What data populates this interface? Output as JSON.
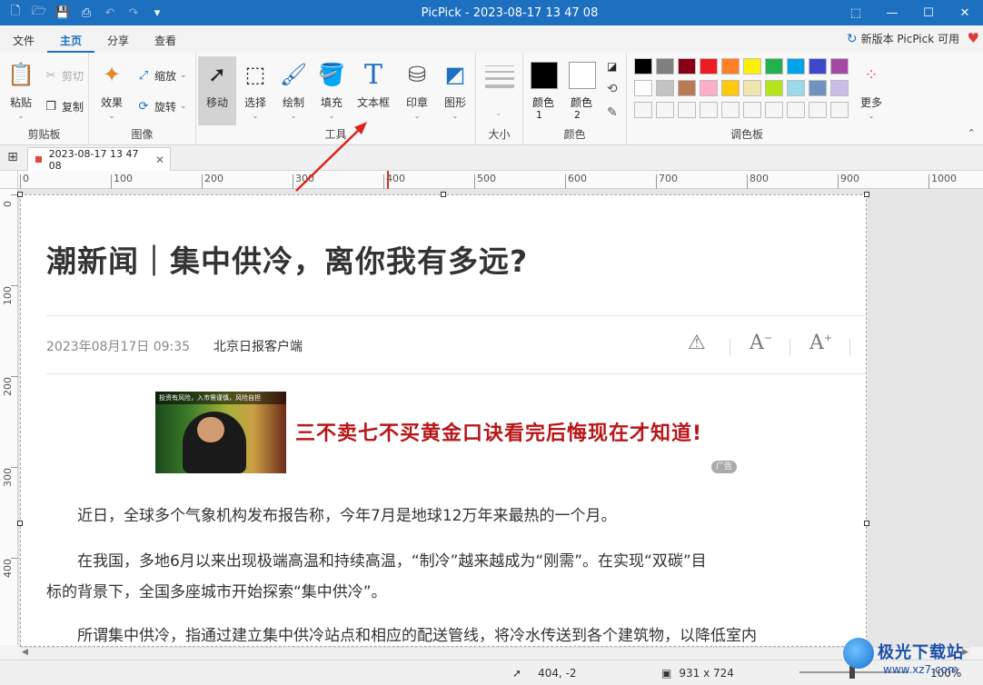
{
  "window": {
    "title": "PicPick - 2023-08-17 13 47 08",
    "controls": [
      "⬚",
      "—",
      "☐",
      "✕"
    ]
  },
  "quick_access": [
    "new-file-icon",
    "open-folder-icon",
    "save-icon",
    "print-icon",
    "undo-icon",
    "redo-icon",
    "customize-icon"
  ],
  "menu": {
    "tabs": [
      "文件",
      "主页",
      "分享",
      "查看"
    ],
    "active": "主页",
    "update_notice": "新版本 PicPick 可用"
  },
  "ribbon": {
    "clipboard": {
      "label": "剪贴板",
      "paste": "粘贴",
      "cut": "剪切",
      "copy": "复制"
    },
    "image": {
      "label": "图像",
      "effects": "效果",
      "resize": "缩放",
      "rotate": "旋转"
    },
    "tools": {
      "label": "工具",
      "move": "移动",
      "select": "选择",
      "draw": "绘制",
      "fill": "填充",
      "textbox": "文本框",
      "stamp": "印章",
      "shape": "图形"
    },
    "size": {
      "label": "大小"
    },
    "color": {
      "label": "颜色",
      "color1": "颜色",
      "color1_num": "1",
      "color2": "颜色",
      "color2_num": "2",
      "color1_value": "#000000",
      "color2_value": "#ffffff"
    },
    "palette": {
      "label": "调色板",
      "more": "更多",
      "row1": [
        "#000000",
        "#7f7f7f",
        "#880015",
        "#ed1c24",
        "#ff7f27",
        "#fff200",
        "#22b14c",
        "#00a2e8",
        "#3f48cc",
        "#a349a4"
      ],
      "row2": [
        "#ffffff",
        "#c3c3c3",
        "#b97a57",
        "#ffaec9",
        "#ffc90e",
        "#efe4b0",
        "#b5e61d",
        "#99d9ea",
        "#7092be",
        "#c8bfe7"
      ],
      "row3": [
        "#f5f5f5",
        "#f5f5f5",
        "#f5f5f5",
        "#f5f5f5",
        "#f5f5f5",
        "#f5f5f5",
        "#f5f5f5",
        "#f5f5f5",
        "#f5f5f5",
        "#f5f5f5"
      ]
    }
  },
  "doc_tab": {
    "title": "2023-08-17 13 47 08"
  },
  "ruler": {
    "h_labels": [
      "0",
      "100",
      "200",
      "300",
      "400",
      "500",
      "600",
      "700",
      "800",
      "900",
      "1000"
    ],
    "v_labels": [
      "0",
      "100",
      "200",
      "300",
      "400"
    ]
  },
  "article": {
    "headline": "潮新闻｜集中供冷，离你我有多远?",
    "date": "2023年08月17日 09:35",
    "source": "北京日报客户端",
    "ad": {
      "banner_top": "投资有风险，入市需谨慎，风险自担",
      "text": "三不卖七不买黄金口诀看完后悔现在才知道!",
      "badge": "广告"
    },
    "paragraphs": [
      "近日，全球多个气象机构发布报告称，今年7月是地球12万年来最热的一个月。",
      "在我国，多地6月以来出现极端高温和持续高温，“制冷”越来越成为“刚需”。在实现“双碳”目",
      "标的背景下，全国多座城市开始探索“集中供冷”。",
      "所谓集中供冷，指通过建立集中供冷站点和相应的配送管线，将冷水传送到各个建筑物，以降低室内"
    ]
  },
  "status": {
    "cursor": "404, -2",
    "size": "931 x 724",
    "zoom": "100%"
  },
  "watermark": {
    "title": "极光下载站",
    "url": "www.xz7.com"
  }
}
